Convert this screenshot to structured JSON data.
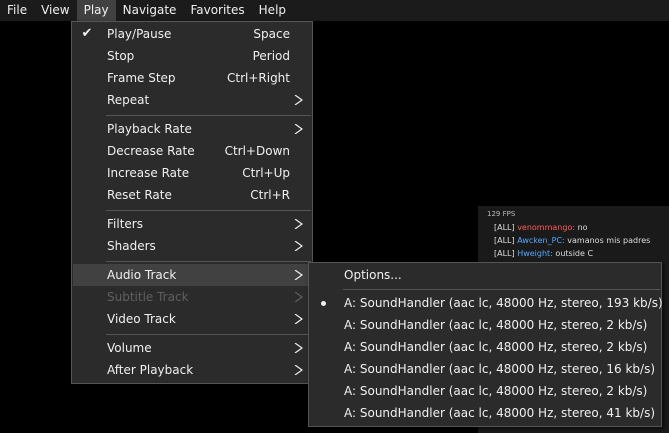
{
  "menubar": {
    "items": [
      "File",
      "View",
      "Play",
      "Navigate",
      "Favorites",
      "Help"
    ]
  },
  "overlay": {
    "fps": "129 FPS",
    "chat": [
      {
        "tag": "[ALL]",
        "name": "venommango:",
        "msg": "no"
      },
      {
        "tag": "[ALL]",
        "name": "Awcken_PC:",
        "msg": "vamanos mis padres"
      },
      {
        "tag": "[ALL]",
        "name": "Hweight:",
        "msg": "outside C"
      }
    ]
  },
  "play_menu": {
    "items": [
      {
        "label": "Play/Pause",
        "shortcut": "Space",
        "checked": true
      },
      {
        "label": "Stop",
        "shortcut": "Period"
      },
      {
        "label": "Frame Step",
        "shortcut": "Ctrl+Right"
      },
      {
        "label": "Repeat",
        "submenu": true
      },
      {
        "label": "Playback Rate",
        "submenu": true
      },
      {
        "label": "Decrease Rate",
        "shortcut": "Ctrl+Down"
      },
      {
        "label": "Increase Rate",
        "shortcut": "Ctrl+Up"
      },
      {
        "label": "Reset Rate",
        "shortcut": "Ctrl+R"
      },
      {
        "label": "Filters",
        "submenu": true
      },
      {
        "label": "Shaders",
        "submenu": true
      },
      {
        "label": "Audio Track",
        "submenu": true,
        "highlighted": true
      },
      {
        "label": "Subtitle Track",
        "submenu": true,
        "disabled": true
      },
      {
        "label": "Video Track",
        "submenu": true
      },
      {
        "label": "Volume",
        "submenu": true
      },
      {
        "label": "After Playback",
        "submenu": true
      }
    ]
  },
  "audio_menu": {
    "options_label": "Options...",
    "tracks": [
      {
        "label": "A: SoundHandler (aac lc, 48000 Hz, stereo, 193 kb/s)",
        "selected": true
      },
      {
        "label": "A: SoundHandler (aac lc, 48000 Hz, stereo, 2 kb/s)"
      },
      {
        "label": "A: SoundHandler (aac lc, 48000 Hz, stereo, 2 kb/s)"
      },
      {
        "label": "A: SoundHandler (aac lc, 48000 Hz, stereo, 16 kb/s)"
      },
      {
        "label": "A: SoundHandler (aac lc, 48000 Hz, stereo, 2 kb/s)"
      },
      {
        "label": "A: SoundHandler (aac lc, 48000 Hz, stereo, 41 kb/s)"
      }
    ]
  },
  "colors": {
    "menu_bg": "#2b2b2b",
    "highlight": "#414141",
    "disabled_text": "#5f5f5f",
    "chat_name": "#56a8ff"
  },
  "icons": [
    "checkmark-icon",
    "submenu-arrow-icon",
    "radio-dot-icon"
  ]
}
